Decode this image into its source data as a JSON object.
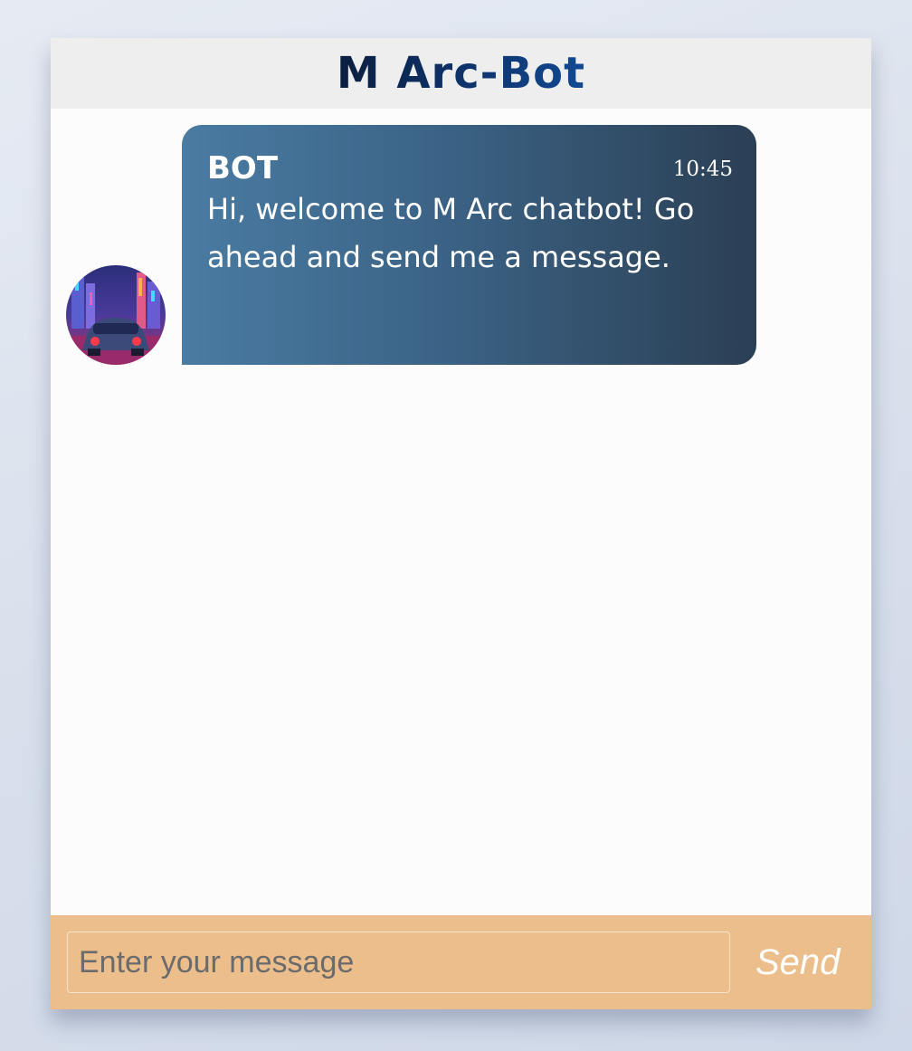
{
  "header": {
    "title": "M Arc-Bot"
  },
  "messages": [
    {
      "sender": "BOT",
      "time": "10:45",
      "text": "Hi, welcome to M Arc chatbot! Go ahead and send me a message.",
      "avatar": "neon-city-car-avatar"
    }
  ],
  "composer": {
    "placeholder": "Enter your message",
    "value": "",
    "send_label": "Send"
  },
  "colors": {
    "header_bg": "#eeeeee",
    "title": "#0e3672",
    "bubble_start": "#4a7ba2",
    "bubble_end": "#2b3f54",
    "footer_bg": "#ebbe8c",
    "page_bg": "#dde4ef"
  }
}
